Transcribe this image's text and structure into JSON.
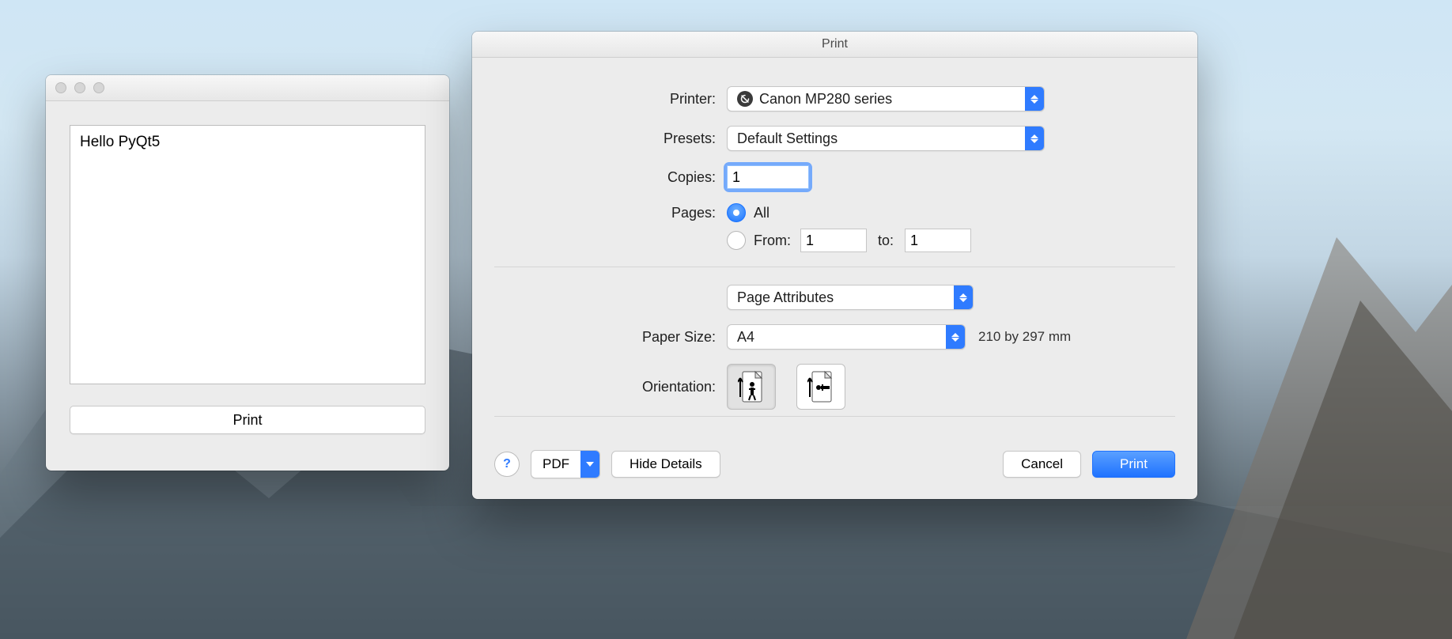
{
  "app_window": {
    "text_content": "Hello PyQt5",
    "print_button": "Print"
  },
  "print_dialog": {
    "title": "Print",
    "labels": {
      "printer": "Printer:",
      "presets": "Presets:",
      "copies": "Copies:",
      "pages": "Pages:",
      "from": "From:",
      "to": "to:",
      "paper_size": "Paper Size:",
      "orientation": "Orientation:"
    },
    "printer": {
      "selected": "Canon MP280 series",
      "status_icon": "offline-icon"
    },
    "presets": {
      "selected": "Default Settings"
    },
    "copies": {
      "value": "1"
    },
    "pages": {
      "mode": "all",
      "all_label": "All",
      "from": "1",
      "to": "1"
    },
    "section_select": "Page Attributes",
    "paper_size": {
      "selected": "A4",
      "dimensions": "210 by 297 mm"
    },
    "orientation": {
      "selected": "portrait"
    },
    "footer": {
      "pdf": "PDF",
      "hide_details": "Hide Details",
      "cancel": "Cancel",
      "print": "Print"
    }
  }
}
